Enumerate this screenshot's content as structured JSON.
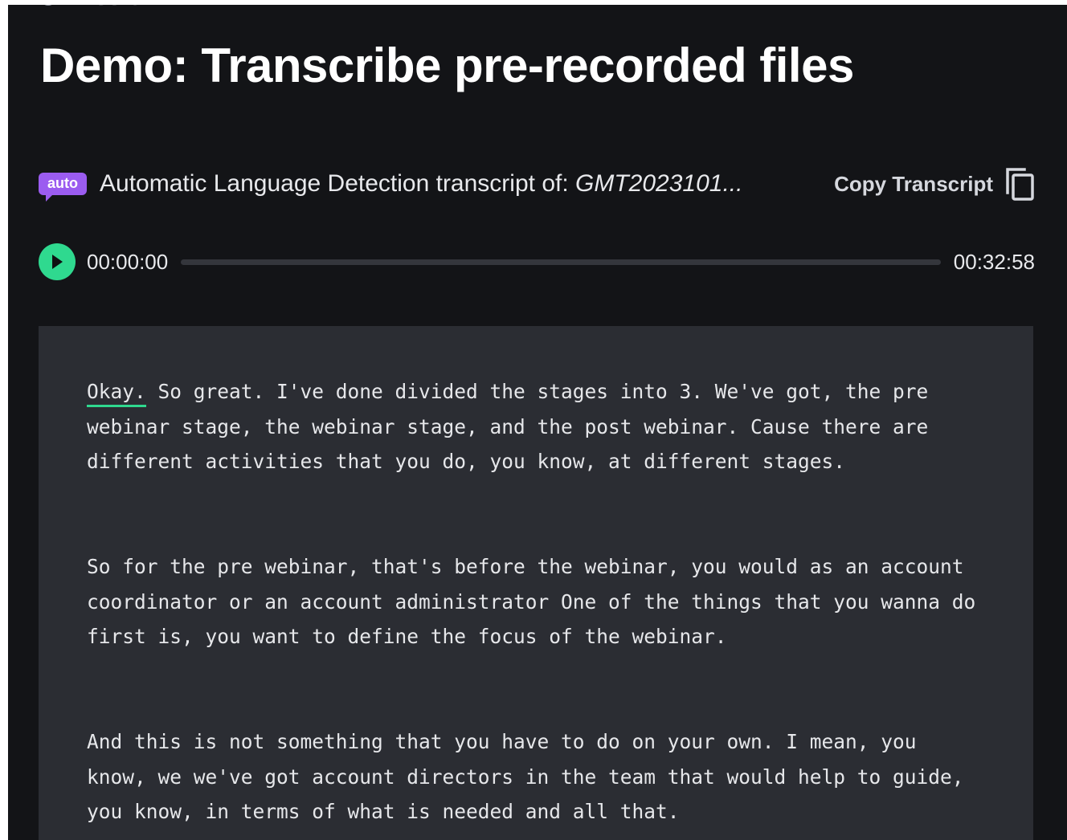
{
  "header": {
    "breadcrumb_label": "Mission",
    "title": "Demo: Transcribe pre-recorded files"
  },
  "transcript_header": {
    "badge": "auto",
    "label": "Automatic Language Detection transcript of: ",
    "file_name": "GMT2023101...",
    "copy_label": "Copy Transcript",
    "copy_icon": "copy-icon"
  },
  "player": {
    "play_icon": "play-icon",
    "current_time": "00:00:00",
    "total_time": "00:32:58",
    "progress_fraction": 0,
    "accent_color": "#2fd98f"
  },
  "transcript": {
    "paragraphs": [
      {
        "highlighted_word": "Okay.",
        "text": " So great. I've done divided the stages into 3. We've got, the pre webinar stage, the webinar stage, and the post webinar. Cause there are different activities that you do, you know, at different stages."
      },
      {
        "text": "So for the pre webinar, that's before the webinar, you would as an account coordinator or an account administrator One of the things that you wanna do first is, you want to define the focus of the webinar."
      },
      {
        "text": "And this is not something that you have to do on your own. I mean, you know, we we've got account directors in the team that would help to guide, you know, in terms of what is needed and all that."
      }
    ]
  },
  "colors": {
    "background": "#131417",
    "panel": "#2b2d33",
    "badge": "#9b5cf0",
    "accent": "#2fd98f"
  }
}
